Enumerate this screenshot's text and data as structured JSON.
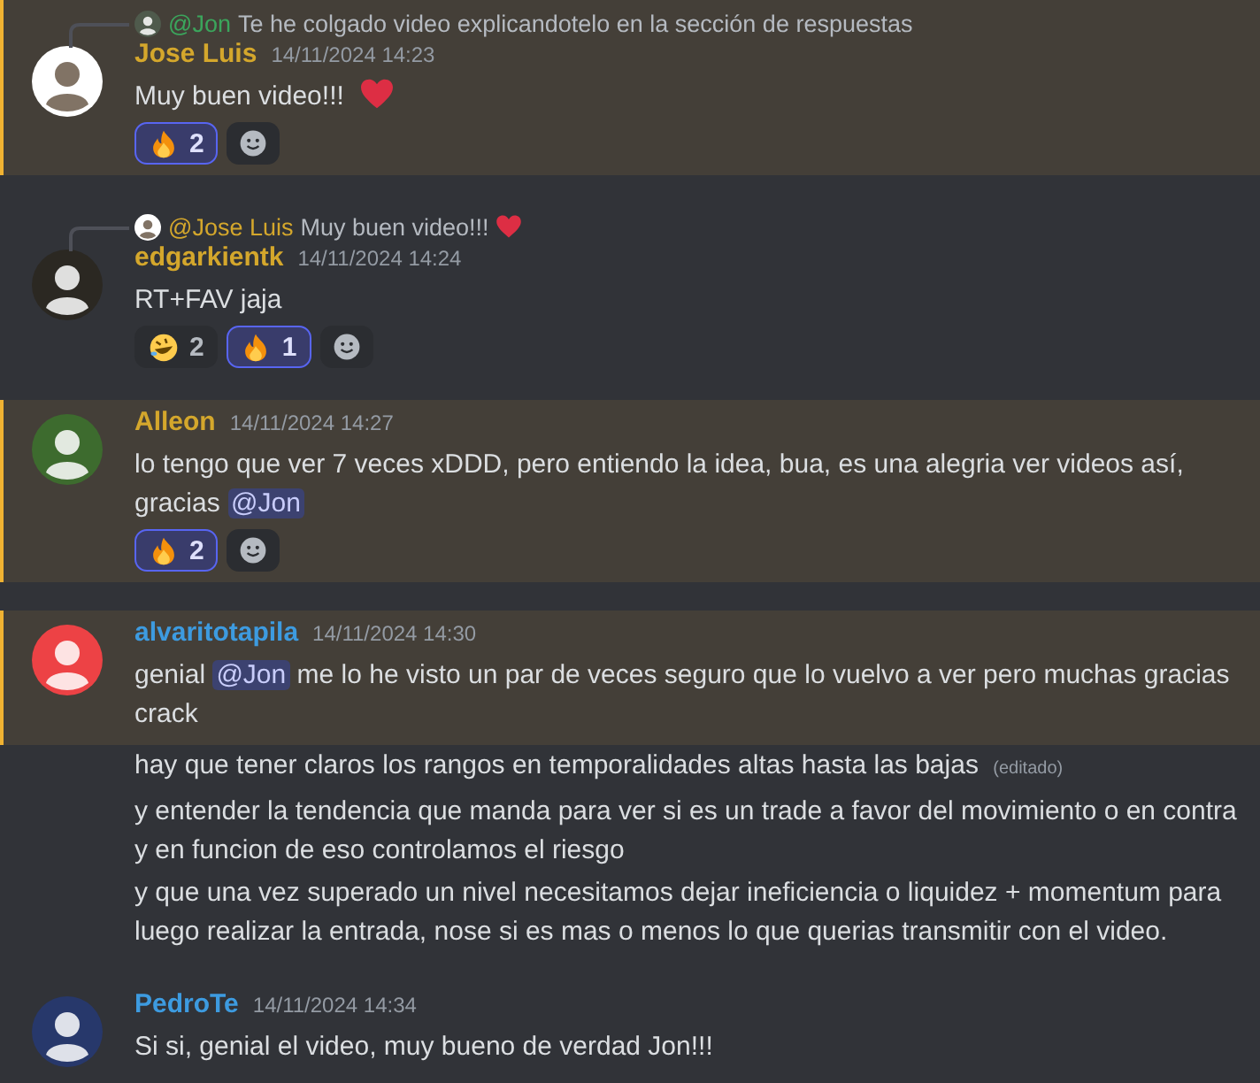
{
  "messages": [
    {
      "highlighted": true,
      "reply": {
        "avatar": {
          "color": "#4f5a4c"
        },
        "mention": "@Jon",
        "color": "#3ba55c",
        "text": "Te he colgado video explicandotelo en la sección de respuestas"
      },
      "avatar": {
        "color": "#ffffff"
      },
      "author": "Jose Luis",
      "color": "#d4a72c",
      "timestamp": "14/11/2024 14:23",
      "lines": [
        {
          "parts": [
            {
              "kind": "text",
              "text": "Muy buen video!!!"
            }
          ],
          "heart": true
        }
      ],
      "reactions": [
        {
          "kind": "fire",
          "count": "2",
          "selected": true
        }
      ]
    },
    {
      "highlighted": false,
      "reply": {
        "avatar": {
          "color": "#ffffff"
        },
        "mention": "@Jose Luis",
        "color": "#d4a72c",
        "text": "Muy buen video!!!",
        "heart": true
      },
      "avatar": {
        "color": "#2b2822"
      },
      "author": "edgarkientk",
      "color": "#d4a72c",
      "timestamp": "14/11/2024 14:24",
      "lines": [
        {
          "parts": [
            {
              "kind": "text",
              "text": "RT+FAV jaja"
            }
          ]
        }
      ],
      "reactions": [
        {
          "kind": "rofl",
          "count": "2",
          "selected": false
        },
        {
          "kind": "fire",
          "count": "1",
          "selected": true
        }
      ]
    },
    {
      "highlighted": true,
      "avatar": {
        "color": "#3d6b2e"
      },
      "author": "Alleon",
      "color": "#d4a72c",
      "timestamp": "14/11/2024 14:27",
      "lines": [
        {
          "parts": [
            {
              "kind": "text",
              "text": "lo tengo que ver 7 veces xDDD, pero entiendo la idea, bua, es una alegria ver videos así, gracias "
            },
            {
              "kind": "mention",
              "text": "@Jon"
            }
          ]
        }
      ],
      "reactions": [
        {
          "kind": "fire",
          "count": "2",
          "selected": true
        }
      ]
    },
    {
      "highlighted": true,
      "avatar": {
        "color": "#ed4245"
      },
      "author": "alvaritotapila",
      "color": "#3d9be0",
      "timestamp": "14/11/2024 14:30",
      "lines": [
        {
          "parts": [
            {
              "kind": "text",
              "text": "genial "
            },
            {
              "kind": "mention",
              "text": "@Jon"
            },
            {
              "kind": "text",
              "text": " me lo he visto un par de veces seguro que lo vuelvo a ver pero muchas gracias crack"
            }
          ]
        }
      ]
    },
    {
      "highlighted": false,
      "lines": [
        {
          "parts": [
            {
              "kind": "text",
              "text": "hay que tener claros los rangos  en temporalidades altas hasta las bajas"
            }
          ],
          "edited": "(editado)"
        }
      ]
    },
    {
      "highlighted": false,
      "lines": [
        {
          "parts": [
            {
              "kind": "text",
              "text": "y entender la tendencia que manda para ver si es un trade a favor del movimiento o en contra  y en funcion de eso controlamos el riesgo"
            }
          ]
        }
      ]
    },
    {
      "highlighted": false,
      "lines": [
        {
          "parts": [
            {
              "kind": "text",
              "text": "y que una vez superado un nivel necesitamos dejar ineficiencia o liquidez  + momentum para luego realizar la entrada, nose si es mas o menos lo que querias transmitir con el video."
            }
          ]
        }
      ]
    },
    {
      "highlighted": false,
      "avatar": {
        "color": "#27386b"
      },
      "author": "PedroTe",
      "color": "#3d9be0",
      "timestamp": "14/11/2024 14:34",
      "lines": [
        {
          "parts": [
            {
              "kind": "text",
              "text": "Si si, genial el video, muy bueno de verdad Jon!!!"
            }
          ]
        }
      ]
    }
  ]
}
